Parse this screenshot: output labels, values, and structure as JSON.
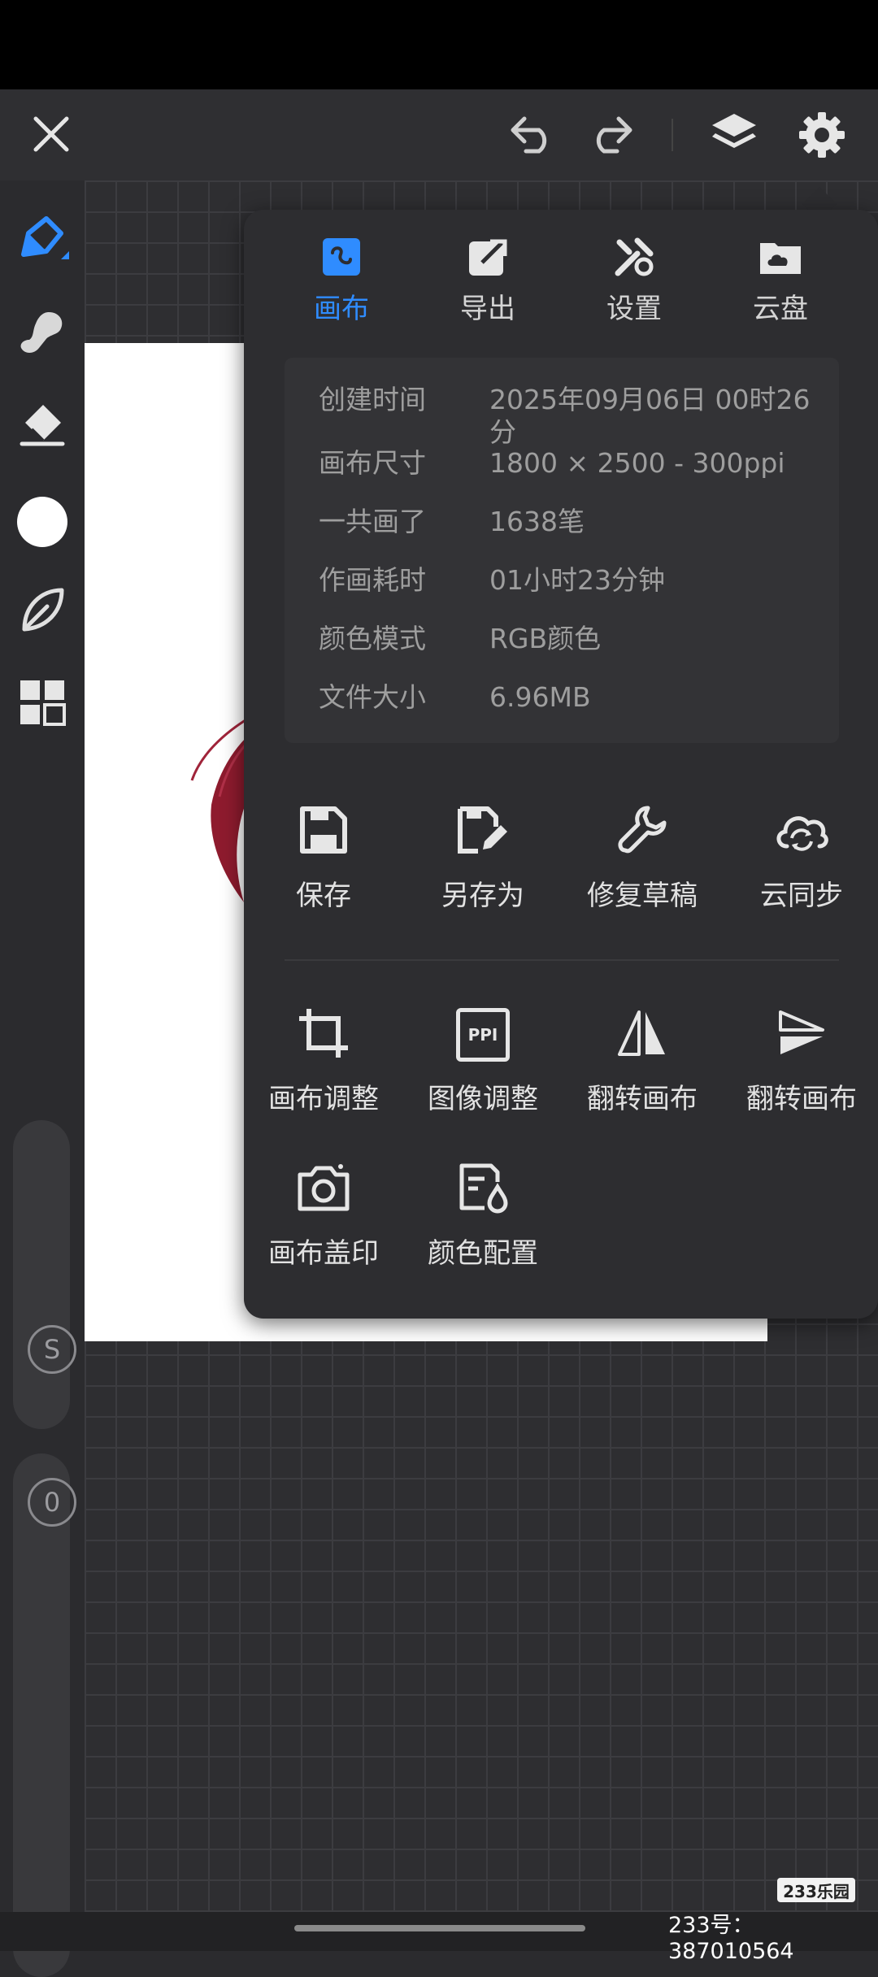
{
  "app": {
    "accent_color": "#2f8cff",
    "toolbar": {
      "close_icon": "close-icon",
      "undo_icon": "undo-icon",
      "redo_icon": "redo-icon",
      "layers_icon": "layers-icon",
      "settings_icon": "gear-icon"
    },
    "sidebar": {
      "tools": [
        "pen-tool-icon",
        "smudge-tool-icon",
        "eraser-tool-icon",
        "color-circle-icon",
        "leaf-brush-icon",
        "grid-menu-icon"
      ],
      "size_slider_label": "S",
      "opacity_slider_label": "0"
    }
  },
  "panel": {
    "tabs": [
      {
        "label": "画布",
        "icon": "canvas-wave-icon",
        "active": true
      },
      {
        "label": "导出",
        "icon": "export-icon",
        "active": false
      },
      {
        "label": "设置",
        "icon": "tools-icon",
        "active": false
      },
      {
        "label": "云盘",
        "icon": "cloud-folder-icon",
        "active": false
      }
    ],
    "info": [
      {
        "key": "创建时间",
        "value": "2025年09月06日 00时26分"
      },
      {
        "key": "画布尺寸",
        "value": "1800 × 2500 - 300ppi"
      },
      {
        "key": "一共画了",
        "value": "1638笔"
      },
      {
        "key": "作画耗时",
        "value": "01小时23分钟"
      },
      {
        "key": "颜色模式",
        "value": "RGB颜色"
      },
      {
        "key": "文件大小",
        "value": "6.96MB"
      }
    ],
    "actions_row1": [
      {
        "label": "保存",
        "icon": "save-icon"
      },
      {
        "label": "另存为",
        "icon": "save-as-icon"
      },
      {
        "label": "修复草稿",
        "icon": "wrench-icon"
      },
      {
        "label": "云同步",
        "icon": "cloud-sync-icon"
      }
    ],
    "actions_row2": [
      {
        "label": "画布调整",
        "icon": "crop-icon"
      },
      {
        "label": "图像调整",
        "icon": "ppi-icon",
        "icon_text": "PPI"
      },
      {
        "label": "翻转画布",
        "icon": "flip-horizontal-icon"
      },
      {
        "label": "翻转画布",
        "icon": "flip-vertical-icon"
      }
    ],
    "actions_row3": [
      {
        "label": "画布盖印",
        "icon": "camera-icon"
      },
      {
        "label": "颜色配置",
        "icon": "color-profile-icon"
      }
    ]
  },
  "watermark": {
    "logo_text": "233乐园",
    "id_text": "233号：387010564"
  }
}
